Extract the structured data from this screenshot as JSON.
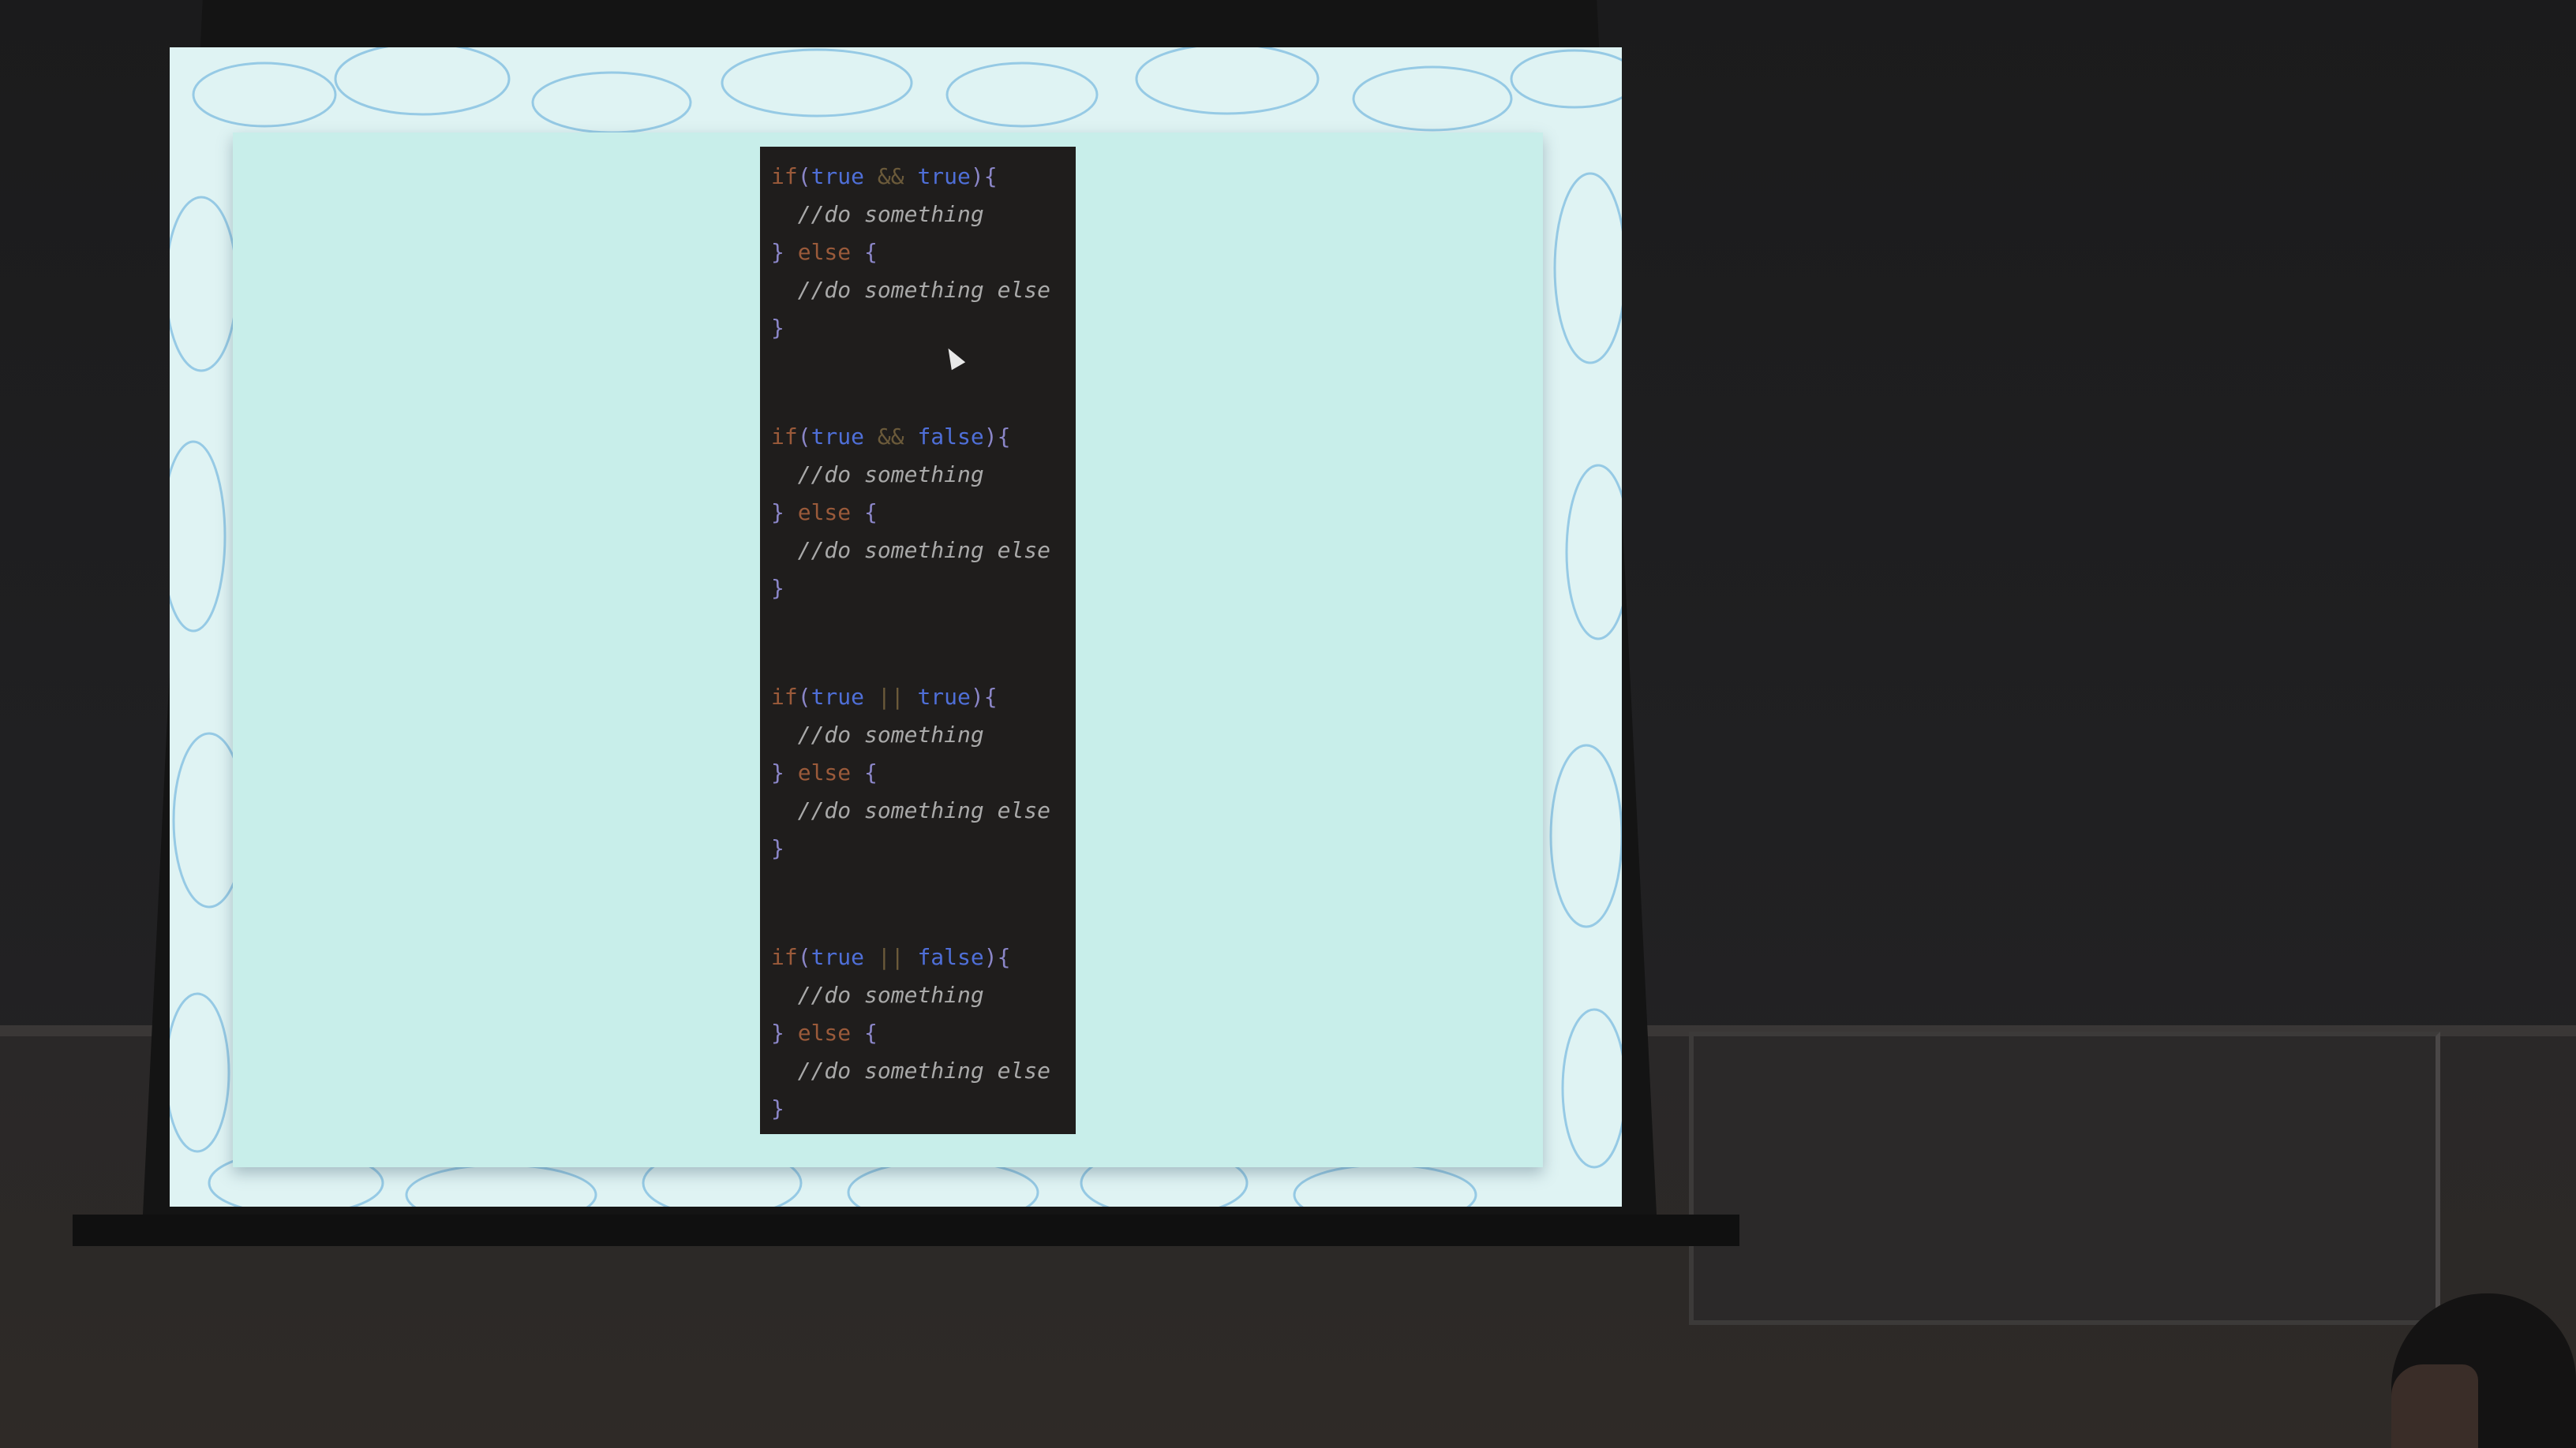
{
  "slide": {
    "snippets": [
      {
        "a": "true",
        "op": "&&",
        "b": "true",
        "then_comment": "//do something",
        "else_comment": "//do something else"
      },
      {
        "a": "true",
        "op": "&&",
        "b": "false",
        "then_comment": "//do something",
        "else_comment": "//do something else"
      },
      {
        "a": "true",
        "op": "||",
        "b": "true",
        "then_comment": "//do something",
        "else_comment": "//do something else"
      },
      {
        "a": "true",
        "op": "||",
        "b": "false",
        "then_comment": "//do something",
        "else_comment": "//do something else"
      }
    ],
    "keywords": {
      "if": "if",
      "else": "else"
    }
  },
  "colors": {
    "screen_bg": "#dff3f3",
    "card_bg": "#c8eeea",
    "code_bg": "#1f1d1c",
    "keyword": "#9a5a3a",
    "boolean": "#4f6fd8",
    "comment": "#a9a9a9",
    "swirl": "#5aa7d8"
  }
}
